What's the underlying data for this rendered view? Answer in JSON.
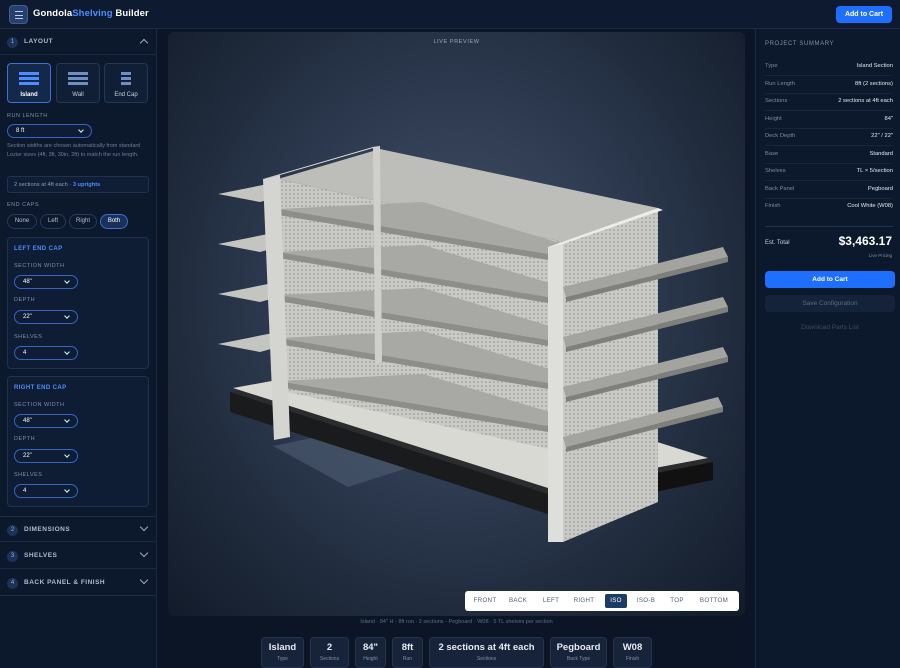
{
  "app": {
    "brand_part1": "Gondola",
    "brand_part2": "Shelving",
    "brand_part3": " Builder",
    "add_to_cart": "Add to Cart"
  },
  "sidebar": {
    "layout": {
      "num": "1",
      "title": "LAYOUT",
      "types": [
        {
          "label": "Island"
        },
        {
          "label": "Wall"
        },
        {
          "label": "End Cap"
        }
      ],
      "run_length_label": "RUN LENGTH",
      "run_length_value": "8 ft",
      "help": "Section widths are chosen automatically from standard Lozier sizes (4ft, 3ft, 30in, 2ft) to match the run length.",
      "summary_text": "2 sections at 4ft each · ",
      "summary_uprights": "3 uprights",
      "end_caps_label": "END CAPS",
      "end_caps_options": [
        "None",
        "Left",
        "Right",
        "Both"
      ],
      "left_cap": {
        "title": "LEFT END CAP",
        "width_label": "SECTION WIDTH",
        "width_value": "48\"",
        "depth_label": "DEPTH",
        "depth_value": "22\"",
        "shelves_label": "SHELVES",
        "shelves_value": "4"
      },
      "right_cap": {
        "title": "RIGHT END CAP",
        "width_label": "SECTION WIDTH",
        "width_value": "48\"",
        "depth_label": "DEPTH",
        "depth_value": "22\"",
        "shelves_label": "SHELVES",
        "shelves_value": "4"
      }
    },
    "sections": [
      {
        "num": "2",
        "title": "DIMENSIONS"
      },
      {
        "num": "3",
        "title": "SHELVES"
      },
      {
        "num": "4",
        "title": "BACK PANEL & FINISH"
      }
    ]
  },
  "viewer": {
    "title": "LIVE PREVIEW",
    "views": [
      "FRONT",
      "BACK",
      "LEFT",
      "RIGHT",
      "ISO",
      "ISO-B",
      "TOP",
      "BOTTOM"
    ],
    "active_view": "ISO",
    "caption": "Island · 84\" H · 8ft run · 2 sections · Pegboard · W08 · 5 TL shelves per section"
  },
  "stats": [
    {
      "value": "Island",
      "key": "Type"
    },
    {
      "value": "2",
      "key": "Sections"
    },
    {
      "value": "84\"",
      "key": "Height"
    },
    {
      "value": "8ft",
      "key": "Run"
    },
    {
      "value": "2 sections at 4ft each",
      "key": "Sections"
    },
    {
      "value": "Pegboard",
      "key": "Back Type"
    },
    {
      "value": "W08",
      "key": "Finish"
    }
  ],
  "summary": {
    "title": "PROJECT SUMMARY",
    "rows": [
      {
        "k": "Type",
        "v": "Island Section"
      },
      {
        "k": "Run Length",
        "v": "8ft (2 sections)"
      },
      {
        "k": "Sections",
        "v": "2 sections at 4ft each"
      },
      {
        "k": "Height",
        "v": "84\""
      },
      {
        "k": "Deck Depth",
        "v": "22\" / 22\""
      },
      {
        "k": "Base",
        "v": "Standard"
      },
      {
        "k": "Shelves",
        "v": "TL × 5/section"
      },
      {
        "k": "Back Panel",
        "v": "Pegboard"
      },
      {
        "k": "Finish",
        "v": "Cool White (W08)"
      }
    ],
    "est_label": "Est. Total",
    "est_value": "$3,463.17",
    "est_sub": "Live Pricing",
    "btn_cart": "Add to Cart",
    "btn_save": "Save Configuration",
    "btn_parts": "Download Parts List"
  },
  "colors": {
    "accent": "#1f6fff",
    "brand_accent": "#4e8dff",
    "bg": "#0b1526"
  }
}
